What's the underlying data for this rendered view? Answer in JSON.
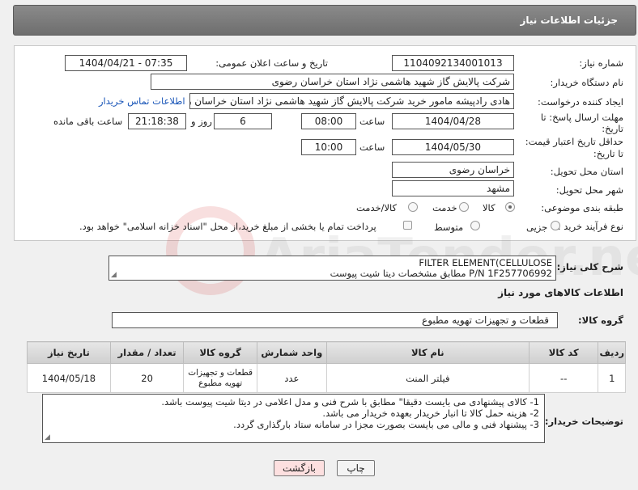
{
  "header": {
    "title": "جزئیات اطلاعات نیاز"
  },
  "watermark": {
    "text": "AriaTender.neT"
  },
  "form": {
    "need_number": {
      "label": "شماره نیاز:",
      "value": "1104092134001013"
    },
    "announce_datetime": {
      "label": "تاریخ و ساعت اعلان عمومی:",
      "value": "1404/04/21 - 07:35"
    },
    "buyer_org": {
      "label": "نام دستگاه خریدار:",
      "value": "شرکت پالایش گاز شهید هاشمی نژاد   استان خراسان رضوی"
    },
    "requester": {
      "label": "ایجاد کننده درخواست:",
      "value": "هادی رادپیشه مامور خرید شرکت پالایش گاز شهید هاشمی نژاد   استان خراسان رضوی"
    },
    "contact_link": "اطلاعات تماس خریدار",
    "reply_deadline": {
      "label_line1": "مهلت ارسال پاسخ: تا",
      "label_line2": "تاریخ:",
      "date": "1404/04/28",
      "time_label": "ساعت",
      "time": "08:00",
      "days": "6",
      "days_label": "روز و",
      "remaining": "21:18:38",
      "remaining_label": "ساعت باقی مانده"
    },
    "price_validity": {
      "label_line1": "حداقل تاریخ اعتبار قیمت:",
      "label_line2": "تا تاریخ:",
      "date": "1404/05/30",
      "time_label": "ساعت",
      "time": "10:00"
    },
    "delivery_province": {
      "label": "استان محل تحویل:",
      "value": "خراسان رضوی"
    },
    "delivery_city": {
      "label": "شهر محل تحویل:",
      "value": "مشهد"
    },
    "category": {
      "label": "طبقه بندی موضوعی:",
      "options": [
        "کالا",
        "خدمت",
        "کالا/خدمت"
      ],
      "selected": "کالا"
    },
    "process_type": {
      "label": "نوع فرآیند خرید :",
      "options": [
        "جزیی",
        "متوسط"
      ],
      "note": "پرداخت تمام یا بخشی از مبلغ خرید،از محل \"اسناد خزانه اسلامی\" خواهد بود."
    }
  },
  "description": {
    "label": "شرح کلی نیاز:",
    "line1": "FILTER ELEMENT(CELLULOSE",
    "line2": "P/N 1F257706992 مطابق مشخصات دیتا شیت پیوست"
  },
  "goods_info": {
    "title": "اطلاعات کالاهای مورد نیاز",
    "group_label": "گروه کالا:",
    "group_value": "قطعات و تجهیزات تهویه مطبوع"
  },
  "table": {
    "headers": [
      "ردیف",
      "کد کالا",
      "نام کالا",
      "واحد شمارش",
      "گروه کالا",
      "تعداد / مقدار",
      "تاریخ نیاز"
    ],
    "rows": [
      [
        "1",
        "--",
        "فیلتر المنت",
        "عدد",
        "قطعات و تجهیزات تهویه مطبوع",
        "20",
        "1404/05/18"
      ]
    ]
  },
  "buyer_notes": {
    "label": "توضیحات خریدار:",
    "lines": [
      "1-   کالای پیشنهادی می بایست دقیقا\" مطابق با شرح فنی و مدل اعلامی در دیتا شیت پیوست باشد.",
      "2-   هزینه حمل کالا تا انبار خریدار بعهده خریدار می باشد.",
      "3-   پیشنهاد فنی و مالی می بایست بصورت مجزا در سامانه ستاد بارگذاری گردد."
    ]
  },
  "buttons": {
    "print": "چاپ",
    "back": "بازگشت"
  },
  "colors": {
    "link": "#1a56b8",
    "back_button": "#fde0e0",
    "print_button": "#f4f4f4"
  }
}
